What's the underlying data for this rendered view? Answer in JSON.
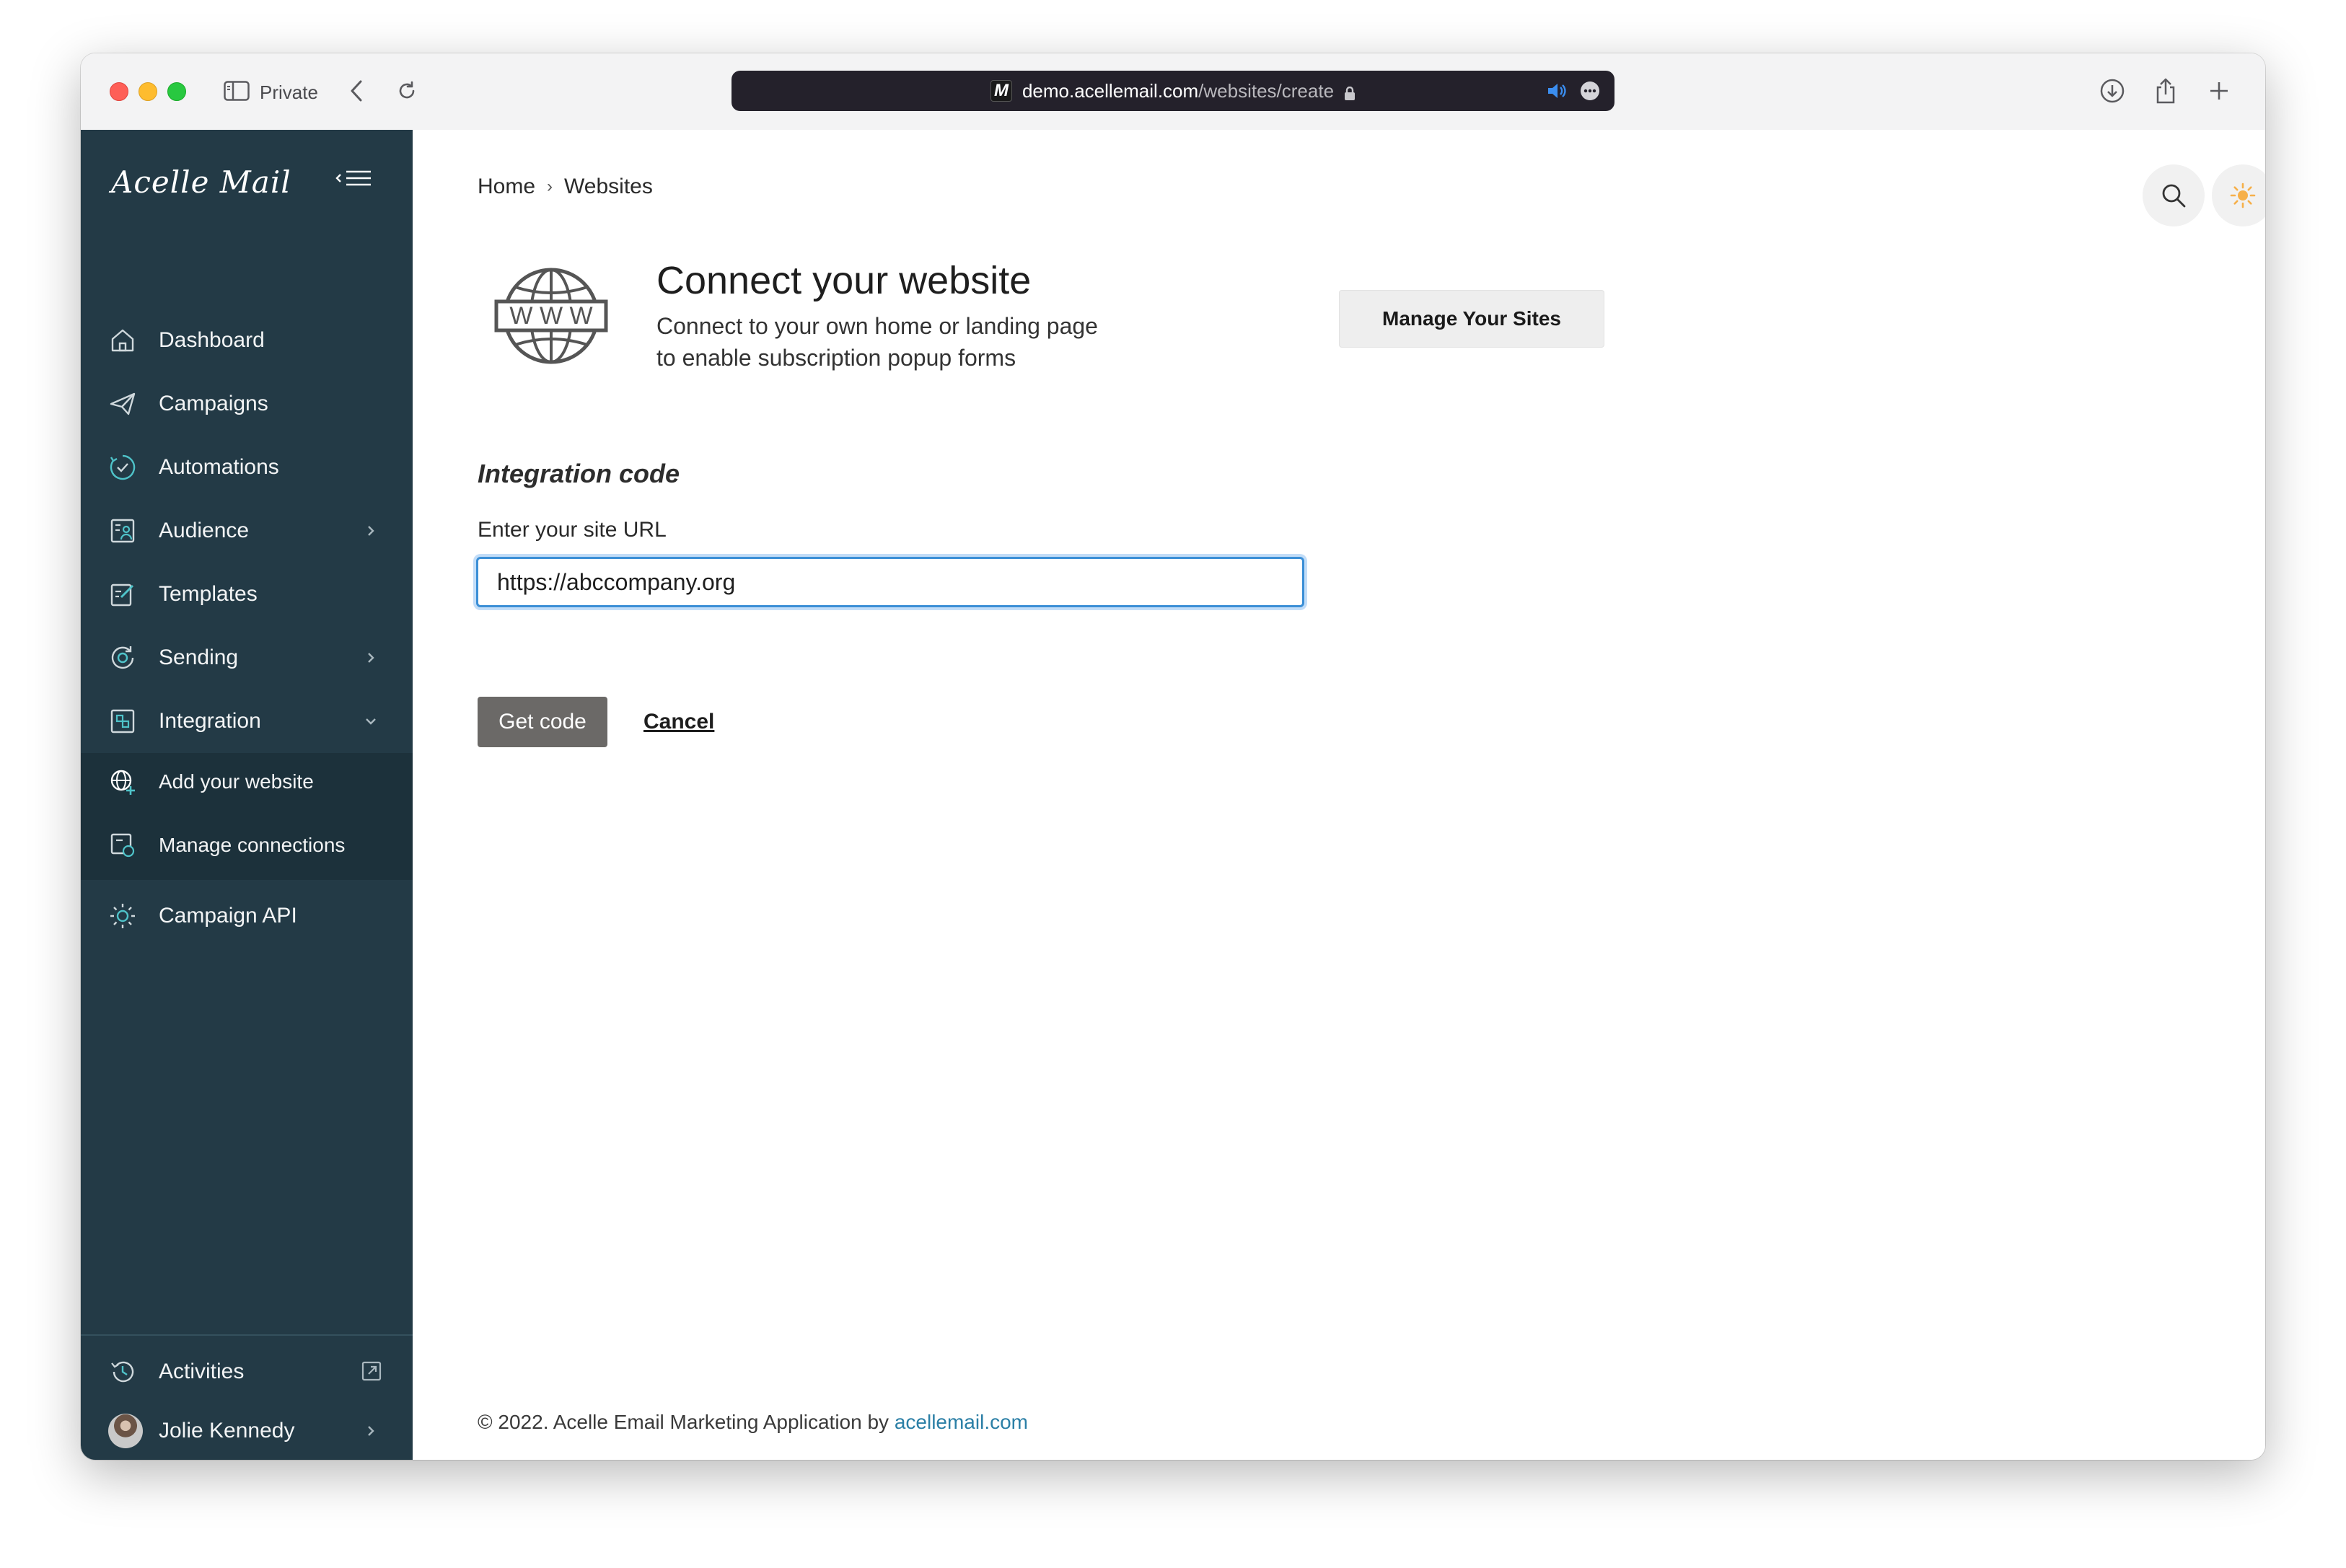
{
  "browser": {
    "private_label": "Private",
    "url_host": "demo.acellemail.com",
    "url_path": "/websites/create",
    "favicon_letter": "M"
  },
  "sidebar": {
    "logo": "Acelle Mail",
    "items": [
      {
        "label": "Dashboard",
        "icon": "home-icon"
      },
      {
        "label": "Campaigns",
        "icon": "paper-plane-icon"
      },
      {
        "label": "Automations",
        "icon": "automation-icon"
      },
      {
        "label": "Audience",
        "icon": "audience-icon",
        "has_chevron": true
      },
      {
        "label": "Templates",
        "icon": "template-icon"
      },
      {
        "label": "Sending",
        "icon": "sending-icon",
        "has_chevron": true
      },
      {
        "label": "Integration",
        "icon": "integration-icon",
        "expanded": true
      },
      {
        "label": "Add your website",
        "icon": "globe-add-icon",
        "sub": true,
        "active": true
      },
      {
        "label": "Manage connections",
        "icon": "connections-icon",
        "sub": true
      },
      {
        "label": "Campaign API",
        "icon": "api-gear-icon"
      }
    ],
    "activities_label": "Activities",
    "user_name": "Jolie Kennedy"
  },
  "breadcrumb": [
    "Home",
    "Websites"
  ],
  "header": {
    "title": "Connect your website",
    "subtitle_line1": "Connect to your own home or landing page",
    "subtitle_line2": "to enable subscription popup forms",
    "manage_button": "Manage Your Sites",
    "globe_text": "W W W"
  },
  "form": {
    "section_title": "Integration code",
    "url_label": "Enter your site URL",
    "url_value": "https://abccompany.org",
    "submit_label": "Get code",
    "cancel_label": "Cancel"
  },
  "footer": {
    "text": "© 2022. Acelle Email Marketing Application by ",
    "link": "acellemail.com"
  },
  "colors": {
    "sidebar_bg": "#233a46",
    "sidebar_active_bg": "#1c313b",
    "accent_link": "#2b7fa6",
    "primary_button": "#6b6967"
  }
}
